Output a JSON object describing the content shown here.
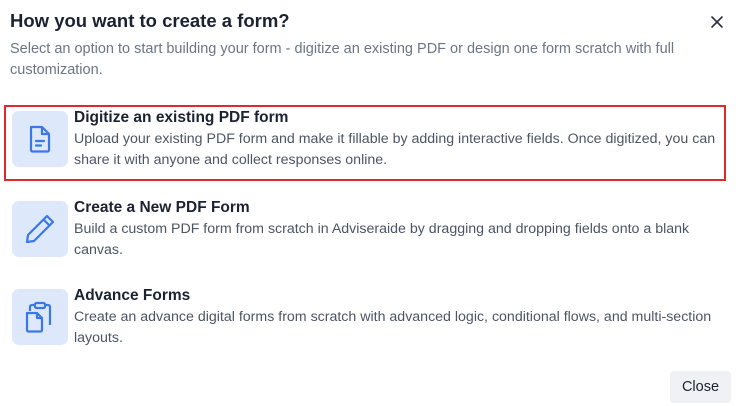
{
  "dialog": {
    "title": "How you want to create a form?",
    "subtitle": "Select an option to start building your form - digitize an existing PDF or design one form scratch with full customization.",
    "close_icon": "close-icon",
    "close_button_label": "Close"
  },
  "options": [
    {
      "icon": "document-icon",
      "title": "Digitize an existing PDF form",
      "description": "Upload your existing PDF form and make it fillable by adding interactive fields. Once digitized, you can share it with anyone and collect responses online.",
      "selected": true
    },
    {
      "icon": "pencil-icon",
      "title": "Create a New PDF Form",
      "description": "Build a custom PDF form from scratch in Adviseraide by dragging and dropping fields onto a blank canvas.",
      "selected": false
    },
    {
      "icon": "clipboard-icon",
      "title": "Advance Forms",
      "description": "Create an advance digital forms from scratch with advanced logic, conditional flows, and multi-section layouts.",
      "selected": false
    }
  ],
  "colors": {
    "accent_icon": "#3b78e7",
    "icon_background": "#dde8fb",
    "selected_border": "#e02a2a"
  }
}
